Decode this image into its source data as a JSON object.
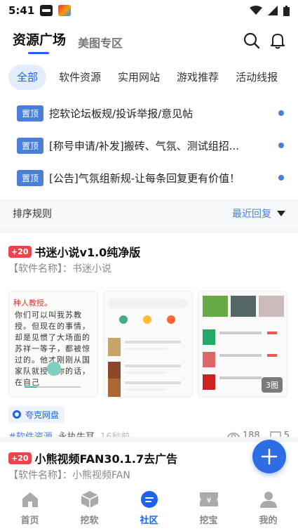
{
  "status": {
    "time": "5:41"
  },
  "header": {
    "tab_active": "资源广场",
    "tab_other": "美图专区"
  },
  "categories": [
    "全部",
    "软件资源",
    "实用网站",
    "游戏推荐",
    "活动线报"
  ],
  "pinned": [
    {
      "tag": "置顶",
      "text": "挖软论坛板规/投诉举报/意见帖"
    },
    {
      "tag": "置顶",
      "text": "[称号申请/补发]搬砖、气氛、测试组招..."
    },
    {
      "tag": "置顶",
      "text": "[公告]气氛组新规-让每条回复更有价值！"
    }
  ],
  "sort": {
    "label": "排序规则",
    "value": "最近回复"
  },
  "posts": [
    {
      "badge": "+20",
      "title": "书迷小说v1.0纯净版",
      "subtitle": "【软件名称】：书迷小说",
      "source": "夸克网盘",
      "topic": "#软件资源",
      "author": "永执牛耳",
      "time": "16秒前",
      "views": "188",
      "comments": "5",
      "image_count": "3图",
      "thumb1_heading": "种人教授。",
      "thumb1_text": "你们可以叫我苏教授。但现在的事情，却是见惯了大场面的苏祥一等子，都被惊过的。他才刚刚从国家队就授让你的话，在自己"
    },
    {
      "badge": "+20",
      "title": "小熊视频FAN30.1.7去广告",
      "subtitle": "【软件名称】：小熊视频FAN"
    }
  ],
  "nav": [
    "首页",
    "挖软",
    "社区",
    "挖宝",
    "我的"
  ],
  "colors": {
    "accent": "#1e63e9",
    "pin_tag": "#4a7fd8",
    "badge": "#e8464c"
  }
}
